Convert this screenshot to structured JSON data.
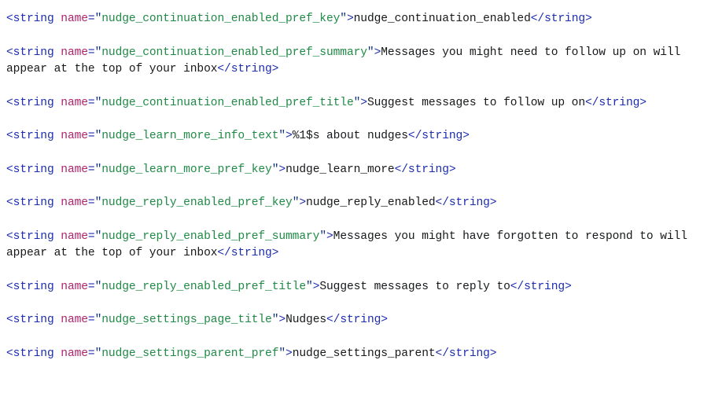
{
  "document": {
    "type": "android-xml-string-resources",
    "language": "xml",
    "colors": {
      "background": "#ffffff",
      "tag": "#1c2db0",
      "attribute_name": "#b0246b",
      "attribute_value": "#1f8a46",
      "quote": "#11337a",
      "text_content": "#16181a"
    },
    "open_tag": "<string",
    "close_tag": "</string>",
    "attribute_name": "name",
    "equals": "=",
    "quote": "\"",
    "gt": ">",
    "entries": [
      {
        "name": "nudge_continuation_enabled_pref_key",
        "value": "nudge_continuation_enabled"
      },
      {
        "name": "nudge_continuation_enabled_pref_summary",
        "value": "Messages you might need to follow up on will appear at the top of your inbox"
      },
      {
        "name": "nudge_continuation_enabled_pref_title",
        "value": "Suggest messages to follow up on"
      },
      {
        "name": "nudge_learn_more_info_text",
        "value": "%1$s about nudges"
      },
      {
        "name": "nudge_learn_more_pref_key",
        "value": "nudge_learn_more"
      },
      {
        "name": "nudge_reply_enabled_pref_key",
        "value": "nudge_reply_enabled"
      },
      {
        "name": "nudge_reply_enabled_pref_summary",
        "value": "Messages you might have forgotten to respond to will appear at the top of your inbox"
      },
      {
        "name": "nudge_reply_enabled_pref_title",
        "value": "Suggest messages to reply to"
      },
      {
        "name": "nudge_settings_page_title",
        "value": "Nudges"
      },
      {
        "name": "nudge_settings_parent_pref",
        "value": "nudge_settings_parent"
      }
    ]
  }
}
